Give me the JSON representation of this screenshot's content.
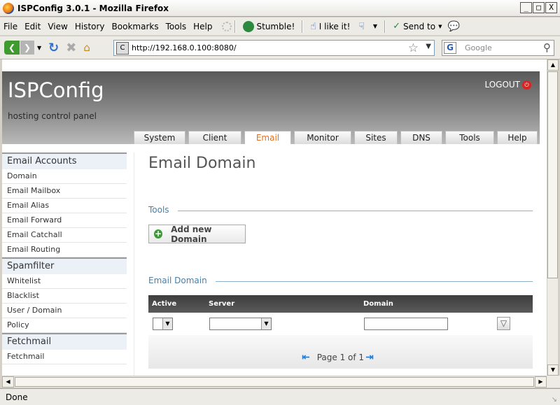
{
  "window": {
    "title": "ISPConfig 3.0.1 - Mozilla Firefox",
    "buttons": [
      "_",
      "□",
      "X"
    ]
  },
  "menubar": {
    "items": [
      "File",
      "Edit",
      "View",
      "History",
      "Bookmarks",
      "Tools",
      "Help"
    ],
    "toolbar": {
      "stumble": "Stumble!",
      "ilike": "I like it!",
      "sendto": "Send to"
    }
  },
  "navbar": {
    "url": "http://192.168.0.100:8080/",
    "search_placeholder": "Google"
  },
  "header": {
    "logo": "ISPConfig",
    "subtitle": "hosting control panel",
    "logout": "LOGOUT"
  },
  "tabs": [
    {
      "label": "System",
      "active": false
    },
    {
      "label": "Client",
      "active": false
    },
    {
      "label": "Email",
      "active": true
    },
    {
      "label": "Monitor",
      "active": false
    },
    {
      "label": "Sites",
      "active": false
    },
    {
      "label": "DNS",
      "active": false
    },
    {
      "label": "Tools",
      "active": false
    },
    {
      "label": "Help",
      "active": false
    }
  ],
  "sidebar": {
    "sections": [
      {
        "title": "Email Accounts",
        "items": [
          "Domain",
          "Email Mailbox",
          "Email Alias",
          "Email Forward",
          "Email Catchall",
          "Email Routing"
        ]
      },
      {
        "title": "Spamfilter",
        "items": [
          "Whitelist",
          "Blacklist",
          "User / Domain",
          "Policy"
        ]
      },
      {
        "title": "Fetchmail",
        "items": [
          "Fetchmail"
        ]
      }
    ]
  },
  "main": {
    "page_title": "Email Domain",
    "tools_label": "Tools",
    "add_button": "Add new Domain",
    "list_label": "Email Domain",
    "columns": {
      "active": "Active",
      "server": "Server",
      "domain": "Domain"
    },
    "pager": "Page 1 of 1"
  },
  "status": {
    "text": "Done"
  }
}
